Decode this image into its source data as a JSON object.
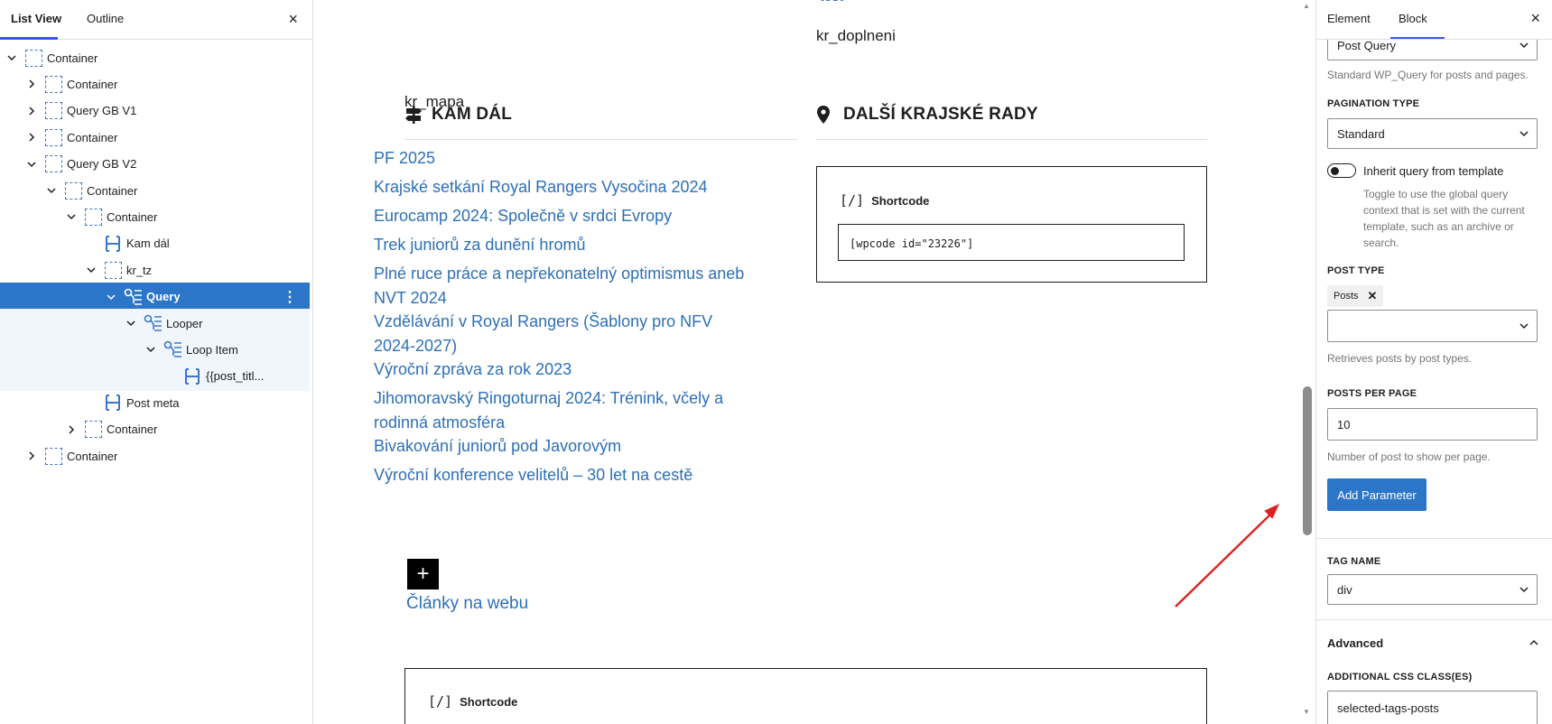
{
  "left_panel": {
    "tabs": [
      "List View",
      "Outline"
    ],
    "close_label": "×",
    "tree": [
      {
        "label": "Container",
        "expanded": true
      },
      {
        "label": "Container",
        "expanded": false
      },
      {
        "label": "Query GB V1",
        "expanded": false
      },
      {
        "label": "Container",
        "expanded": false
      },
      {
        "label": "Query GB V2",
        "expanded": true
      },
      {
        "label": "Container",
        "expanded": true
      },
      {
        "label": "Container",
        "expanded": true
      },
      {
        "label": "Kam dál"
      },
      {
        "label": "kr_tz",
        "expanded": true
      },
      {
        "label": "Query",
        "expanded": true,
        "selected": true
      },
      {
        "label": "Looper",
        "expanded": true
      },
      {
        "label": "Loop Item",
        "expanded": true
      },
      {
        "label": "{{post_titl..."
      },
      {
        "label": "Post meta"
      },
      {
        "label": "Container",
        "expanded": false
      },
      {
        "label": "Container",
        "expanded": false
      }
    ]
  },
  "canvas": {
    "top_cut_link": "test",
    "kr_doplneni": "kr_doplneni",
    "kr_mapa": "kr_mapa",
    "heading_left": "KAM DÁL",
    "heading_right": "DALŠÍ KRAJSKÉ RADY",
    "posts": [
      "PF 2025",
      "Krajské setkání Royal Rangers Vysočina 2024",
      "Eurocamp 2024: Společně v srdci Evropy",
      "Trek juniorů za dunění hromů",
      "Plné ruce práce a nepřekonatelný optimismus aneb NVT 2024",
      "Vzdělávání v Royal Rangers (Šablony pro NFV 2024-2027)",
      "Výroční zpráva za rok 2023",
      "Jihomoravský Ringoturnaj 2024: Trénink, včely a rodinná atmosféra",
      "Bivakování juniorů pod Javorovým",
      "Výroční konference velitelů – 30 let na cestě"
    ],
    "add_button": "+",
    "clanky_link": "Články na webu",
    "shortcode_label": "Shortcode",
    "shortcode_glyph": "[/]",
    "shortcode_value": "[wpcode id=\"23226\"]",
    "shortcode2_label": "Shortcode"
  },
  "right_panel": {
    "tabs": [
      "Element",
      "Block"
    ],
    "close_label": "×",
    "query_type_value": "Post Query",
    "query_type_help": "Standard WP_Query for posts and pages.",
    "pagination_caption": "PAGINATION TYPE",
    "pagination_value": "Standard",
    "inherit_label": "Inherit query from template",
    "inherit_on": false,
    "inherit_help": "Toggle to use the global query context that is set with the current template, such as an archive or search.",
    "post_type_caption": "POST TYPE",
    "post_type_chip": "Posts",
    "post_type_help": "Retrieves posts by post types.",
    "ppp_caption": "POSTS PER PAGE",
    "ppp_value": "10",
    "ppp_help": "Number of post to show per page.",
    "add_param_label": "Add Parameter",
    "tag_caption": "TAG NAME",
    "tag_value": "div",
    "advanced_label": "Advanced",
    "css_caption": "ADDITIONAL CSS CLASS(ES)",
    "css_value": "selected-tags-posts"
  },
  "colors": {
    "accent": "#2c76c9",
    "link": "#2d6fb8",
    "arrow": "#e02020"
  }
}
